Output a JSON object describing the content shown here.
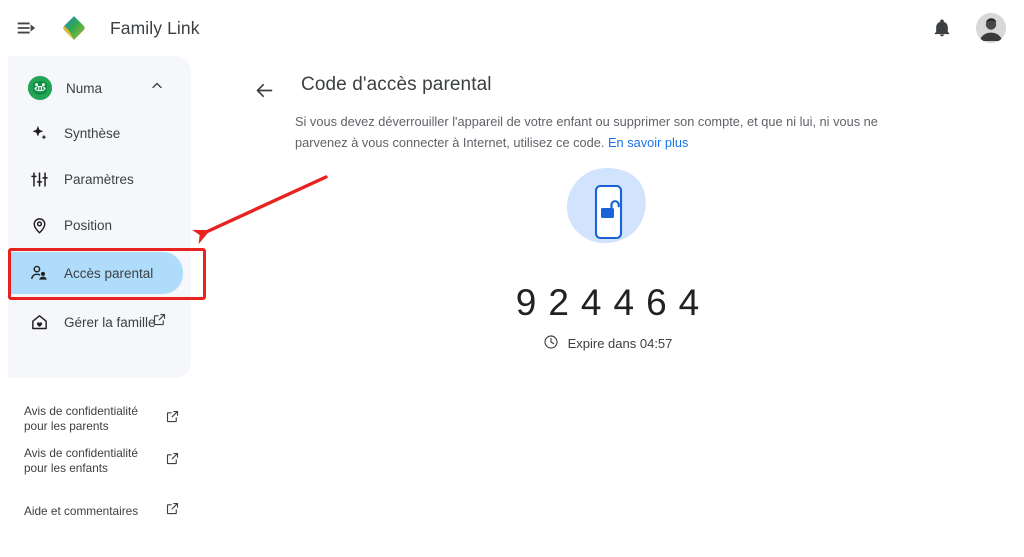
{
  "app": {
    "title": "Family Link",
    "logo_icon": "family-link-diamond-logo",
    "menu_icon": "menu-open-icon",
    "bell_icon": "notifications-bell-icon",
    "avatar_icon": "user-avatar",
    "accent_blue": "#1a73e8",
    "active_pill": "#aedcfa",
    "sidebar_bg": "#f6f7fb",
    "annotation_red": "#e8231f"
  },
  "sidebar": {
    "account": {
      "name": "Numa",
      "avatar_icon": "child-avatar-green",
      "chevron_icon": "chevron-up-icon"
    },
    "items": [
      {
        "label": "Synthèse",
        "icon": "sparkle-icon",
        "active": false,
        "external": false
      },
      {
        "label": "Paramètres",
        "icon": "tune-sliders-icon",
        "active": false,
        "external": false
      },
      {
        "label": "Position",
        "icon": "location-pin-icon",
        "active": false,
        "external": false
      },
      {
        "label": "Accès parental",
        "icon": "supervised-user-icon",
        "active": true,
        "external": false
      },
      {
        "label": "Gérer la famille",
        "icon": "home-heart-icon",
        "active": false,
        "external": true
      }
    ],
    "footer_links": [
      {
        "label": "Avis de confidentialité pour les parents",
        "icon": "external-link-icon"
      },
      {
        "label": "Avis de confidentialité pour les enfants",
        "icon": "external-link-icon"
      },
      {
        "label": "Aide et commentaires",
        "icon": "external-link-icon"
      }
    ]
  },
  "main": {
    "back_icon": "arrow-back-icon",
    "title": "Code d'accès parental",
    "description": "Si vous devez déverrouiller l'appareil de votre enfant ou supprimer son compte, et que ni lui, ni vous ne parvenez à vous connecter à Internet, utilisez ce code.",
    "learn_more": "En savoir plus",
    "illustration_icon": "phone-unlock-illustration",
    "code": "924464",
    "expire_icon": "clock-icon",
    "expire_text": "Expire dans 04:57"
  },
  "annotations": {
    "highlight_target": "Accès parental",
    "arrow": "red-arrow-pointing-to-acces-parental"
  }
}
